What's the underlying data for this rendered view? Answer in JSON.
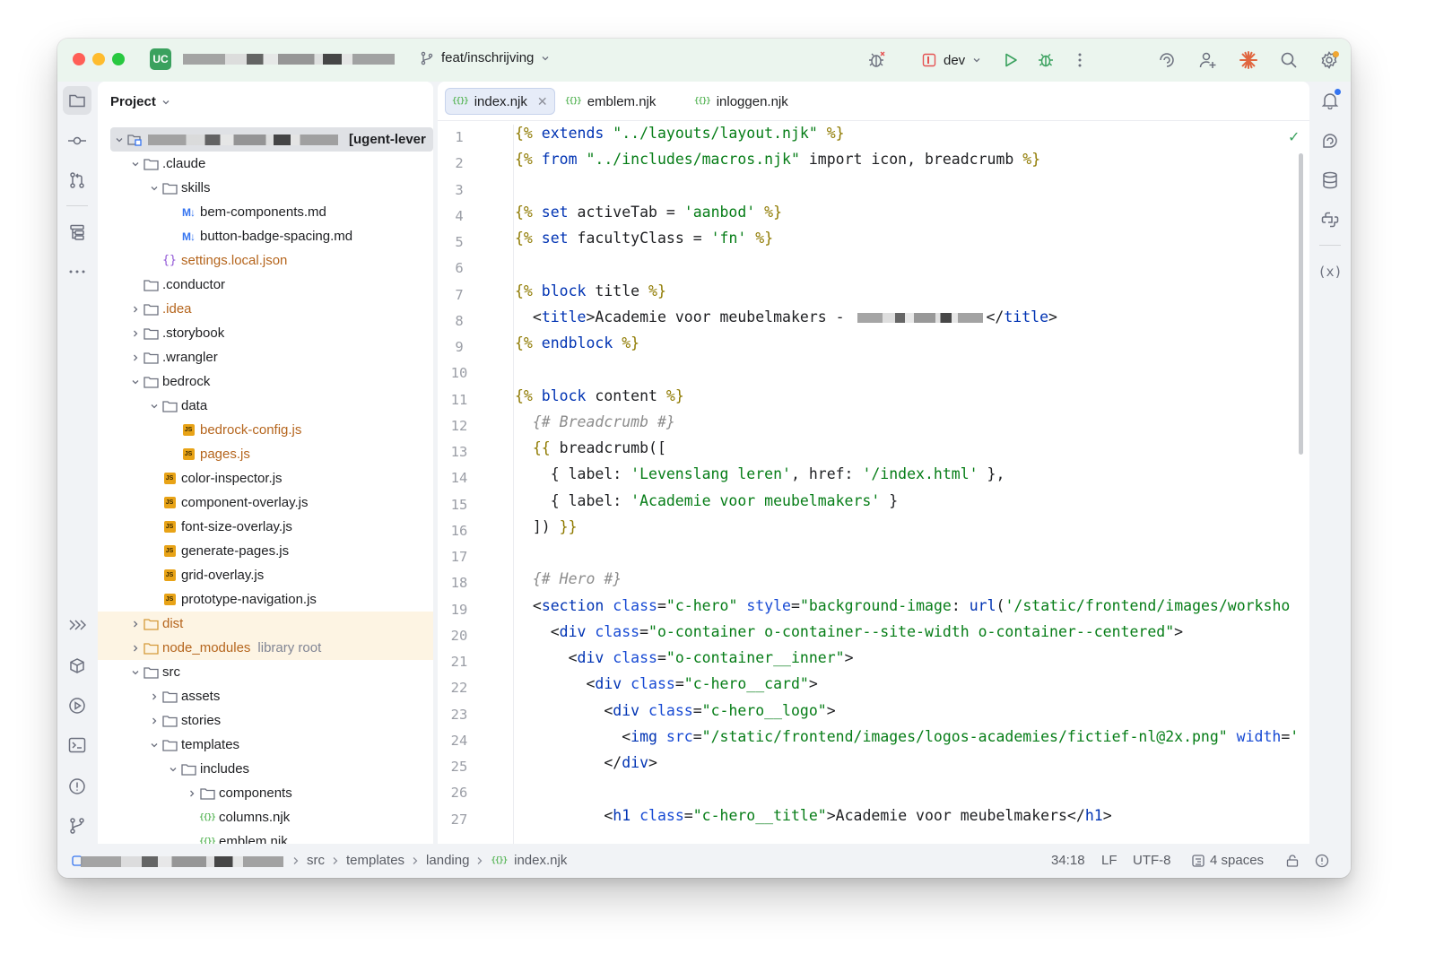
{
  "titlebar": {
    "project_badge": "UC",
    "branch": "feat/inschrijving",
    "run_config": "dev"
  },
  "project_panel": {
    "title": "Project",
    "root_label": "[ugent-lever",
    "tree": [
      {
        "label": ".claude",
        "type": "folder",
        "depth": 1,
        "expanded": true
      },
      {
        "label": "skills",
        "type": "folder",
        "depth": 2,
        "expanded": true
      },
      {
        "label": "bem-components.md",
        "type": "md",
        "depth": 3
      },
      {
        "label": "button-badge-spacing.md",
        "type": "md",
        "depth": 3
      },
      {
        "label": "settings.local.json",
        "type": "json",
        "depth": 2,
        "style": "orange"
      },
      {
        "label": ".conductor",
        "type": "folder",
        "depth": 1,
        "leaf": true
      },
      {
        "label": ".idea",
        "type": "folder",
        "depth": 1,
        "style": "orange"
      },
      {
        "label": ".storybook",
        "type": "folder",
        "depth": 1
      },
      {
        "label": ".wrangler",
        "type": "folder",
        "depth": 1
      },
      {
        "label": "bedrock",
        "type": "folder",
        "depth": 1,
        "expanded": true
      },
      {
        "label": "data",
        "type": "folder",
        "depth": 2,
        "expanded": true
      },
      {
        "label": "bedrock-config.js",
        "type": "js",
        "depth": 3,
        "style": "orange"
      },
      {
        "label": "pages.js",
        "type": "js",
        "depth": 3,
        "style": "orange"
      },
      {
        "label": "color-inspector.js",
        "type": "js",
        "depth": 2
      },
      {
        "label": "component-overlay.js",
        "type": "js",
        "depth": 2
      },
      {
        "label": "font-size-overlay.js",
        "type": "js",
        "depth": 2
      },
      {
        "label": "generate-pages.js",
        "type": "js",
        "depth": 2
      },
      {
        "label": "grid-overlay.js",
        "type": "js",
        "depth": 2
      },
      {
        "label": "prototype-navigation.js",
        "type": "js",
        "depth": 2
      },
      {
        "label": "dist",
        "type": "folder-excl",
        "depth": 1,
        "style": "excl"
      },
      {
        "label": "node_modules",
        "type": "folder-excl",
        "depth": 1,
        "style": "excl",
        "suffix": "library root"
      },
      {
        "label": "src",
        "type": "folder",
        "depth": 1,
        "expanded": true
      },
      {
        "label": "assets",
        "type": "folder",
        "depth": 2
      },
      {
        "label": "stories",
        "type": "folder",
        "depth": 2
      },
      {
        "label": "templates",
        "type": "folder",
        "depth": 2,
        "expanded": true
      },
      {
        "label": "includes",
        "type": "folder",
        "depth": 3,
        "expanded": true
      },
      {
        "label": "components",
        "type": "folder",
        "depth": 4
      },
      {
        "label": "columns.njk",
        "type": "njk",
        "depth": 4,
        "leaf": true
      },
      {
        "label": "emblem.njk",
        "type": "njk",
        "depth": 4,
        "leaf": true
      }
    ]
  },
  "editor": {
    "tabs": [
      {
        "label": "index.njk",
        "active": true
      },
      {
        "label": "emblem.njk",
        "active": false
      },
      {
        "label": "inloggen.njk",
        "active": false
      }
    ],
    "line_numbers": [
      "1",
      "2",
      "3",
      "4",
      "5",
      "6",
      "7",
      "8",
      "9",
      "10",
      "11",
      "12",
      "13",
      "14",
      "15",
      "16",
      "17",
      "18",
      "19",
      "20",
      "21",
      "22",
      "23",
      "24",
      "25",
      "26",
      "27"
    ],
    "lines": [
      [
        [
          "d",
          "{%"
        ],
        [
          "k",
          " extends "
        ],
        [
          "s",
          "\"../layouts/layout.njk\""
        ],
        [
          "d",
          " %}"
        ]
      ],
      [
        [
          "d",
          "{%"
        ],
        [
          "k",
          " from "
        ],
        [
          "s",
          "\"../includes/macros.njk\""
        ],
        [
          "p",
          " import icon, breadcrumb "
        ],
        [
          "d",
          "%}"
        ]
      ],
      [],
      [
        [
          "d",
          "{%"
        ],
        [
          "k",
          " set"
        ],
        [
          "p",
          " activeTab = "
        ],
        [
          "s",
          "'aanbod'"
        ],
        [
          "d",
          " %}"
        ]
      ],
      [
        [
          "d",
          "{%"
        ],
        [
          "k",
          " set"
        ],
        [
          "p",
          " facultyClass = "
        ],
        [
          "s",
          "'fn'"
        ],
        [
          "d",
          " %}"
        ]
      ],
      [],
      [
        [
          "d",
          "{%"
        ],
        [
          "k",
          " block"
        ],
        [
          "p",
          " title "
        ],
        [
          "d",
          "%}"
        ]
      ],
      [
        [
          "p",
          "  <"
        ],
        [
          "t",
          "title"
        ],
        [
          "p",
          ">Academie voor meubelmakers - "
        ],
        [
          "r",
          "          "
        ],
        [
          "p",
          "</"
        ],
        [
          "t",
          "title"
        ],
        [
          "p",
          ">"
        ]
      ],
      [
        [
          "d",
          "{%"
        ],
        [
          "k",
          " endblock"
        ],
        [
          "d",
          " %}"
        ]
      ],
      [],
      [
        [
          "d",
          "{%"
        ],
        [
          "k",
          " block"
        ],
        [
          "p",
          " content "
        ],
        [
          "d",
          "%}"
        ]
      ],
      [
        [
          "c",
          "  {# Breadcrumb #}"
        ]
      ],
      [
        [
          "d",
          "  {{"
        ],
        [
          "p",
          " breadcrumb(["
        ]
      ],
      [
        [
          "p",
          "    { label: "
        ],
        [
          "s",
          "'Levenslang leren'"
        ],
        [
          "p",
          ", href: "
        ],
        [
          "s",
          "'/index.html'"
        ],
        [
          "p",
          " },"
        ]
      ],
      [
        [
          "p",
          "    { label: "
        ],
        [
          "s",
          "'Academie voor meubelmakers'"
        ],
        [
          "p",
          " }"
        ]
      ],
      [
        [
          "p",
          "  ]) "
        ],
        [
          "d",
          "}}"
        ]
      ],
      [],
      [
        [
          "c",
          "  {# Hero #}"
        ]
      ],
      [
        [
          "p",
          "  <"
        ],
        [
          "t",
          "section"
        ],
        [
          "a",
          " class"
        ],
        [
          "p",
          "="
        ],
        [
          "s",
          "\"c-hero\""
        ],
        [
          "a",
          " style"
        ],
        [
          "p",
          "="
        ],
        [
          "s",
          "\"background-image"
        ],
        [
          "p",
          ": "
        ],
        [
          "t",
          "url"
        ],
        [
          "p",
          "("
        ],
        [
          "s",
          "'/static/frontend/images/worksho"
        ]
      ],
      [
        [
          "p",
          "    <"
        ],
        [
          "t",
          "div"
        ],
        [
          "a",
          " class"
        ],
        [
          "p",
          "="
        ],
        [
          "s",
          "\"o-container o-container--site-width o-container--centered\""
        ],
        [
          "p",
          ">"
        ]
      ],
      [
        [
          "p",
          "      <"
        ],
        [
          "t",
          "div"
        ],
        [
          "a",
          " class"
        ],
        [
          "p",
          "="
        ],
        [
          "s",
          "\"o-container__inner\""
        ],
        [
          "p",
          ">"
        ]
      ],
      [
        [
          "p",
          "        <"
        ],
        [
          "t",
          "div"
        ],
        [
          "a",
          " class"
        ],
        [
          "p",
          "="
        ],
        [
          "s",
          "\"c-hero__card\""
        ],
        [
          "p",
          ">"
        ]
      ],
      [
        [
          "p",
          "          <"
        ],
        [
          "t",
          "div"
        ],
        [
          "a",
          " class"
        ],
        [
          "p",
          "="
        ],
        [
          "s",
          "\"c-hero__logo\""
        ],
        [
          "p",
          ">"
        ]
      ],
      [
        [
          "p",
          "            <"
        ],
        [
          "t",
          "img"
        ],
        [
          "a",
          " src"
        ],
        [
          "p",
          "="
        ],
        [
          "s",
          "\"/static/frontend/images/logos-academies/fictief-nl@2x.png\""
        ],
        [
          "a",
          " width"
        ],
        [
          "p",
          "="
        ],
        [
          "s",
          "'"
        ]
      ],
      [
        [
          "p",
          "          </"
        ],
        [
          "t",
          "div"
        ],
        [
          "p",
          ">"
        ]
      ],
      [],
      [
        [
          "p",
          "          <"
        ],
        [
          "t",
          "h1"
        ],
        [
          "a",
          " class"
        ],
        [
          "p",
          "="
        ],
        [
          "s",
          "\"c-hero__title\""
        ],
        [
          "p",
          ">Academie voor meubelmakers</"
        ],
        [
          "t",
          "h1"
        ],
        [
          "p",
          ">"
        ]
      ]
    ]
  },
  "statusbar": {
    "breadcrumb": [
      "src",
      "templates",
      "landing",
      "index.njk"
    ],
    "position": "34:18",
    "line_sep": "LF",
    "encoding": "UTF-8",
    "indent": "4 spaces"
  },
  "colors": {
    "accent": "#3574f0",
    "badge_green": "#3aa15e",
    "keyword": "#0033b3",
    "string": "#067d17",
    "delimiter": "#8f7a00"
  }
}
